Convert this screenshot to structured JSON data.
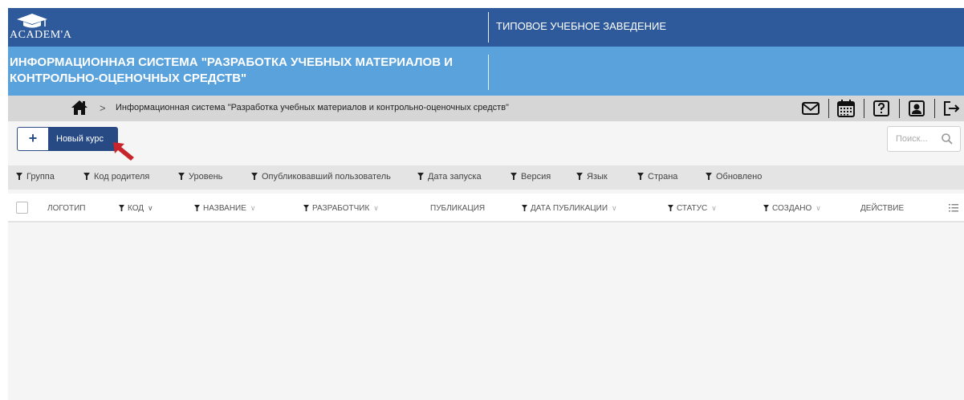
{
  "header": {
    "logo_text": "ACADEM'A",
    "institution": "ТИПОВОЕ УЧЕБНОЕ ЗАВЕДЕНИЕ",
    "system_title": "ИНФОРМАЦИОННАЯ СИСТЕМА \"РАЗРАБОТКА УЧЕБНЫХ МАТЕРИАЛОВ И КОНТРОЛЬНО-ОЦЕНОЧНЫХ СРЕДСТВ\""
  },
  "breadcrumb": {
    "separator": ">",
    "current": "Информационная система \"Разработка учебных материалов и контрольно-оценочных средств\""
  },
  "toolbar": {
    "icons": [
      "mail-icon",
      "calendar-icon",
      "help-icon",
      "profile-icon",
      "logout-icon"
    ]
  },
  "actions": {
    "new_course_plus": "+",
    "new_course_label": "Новый курс"
  },
  "search": {
    "placeholder": "Поиск..."
  },
  "filters": [
    "Группа",
    "Код родителя",
    "Уровень",
    "Опубликовавший пользователь",
    "Дата запуска",
    "Версия",
    "Язык",
    "Страна",
    "Обновлено"
  ],
  "table": {
    "columns": [
      "ЛОГОТИП",
      "КОД",
      "НАЗВАНИЕ",
      "РАЗРАБОТЧИК",
      "ПУБЛИКАЦИЯ",
      "ДАТА ПУБЛИКАЦИИ",
      "СТАТУС",
      "СОЗДАНО",
      "ДЕЙСТВИЕ"
    ],
    "rows": []
  },
  "colors": {
    "topbar": "#2e5a9b",
    "titlebar": "#5aa2dc",
    "breadcrumb_bar": "#d6d6d6",
    "accent_button": "#274a84",
    "pointer_arrow": "#c8242b"
  }
}
